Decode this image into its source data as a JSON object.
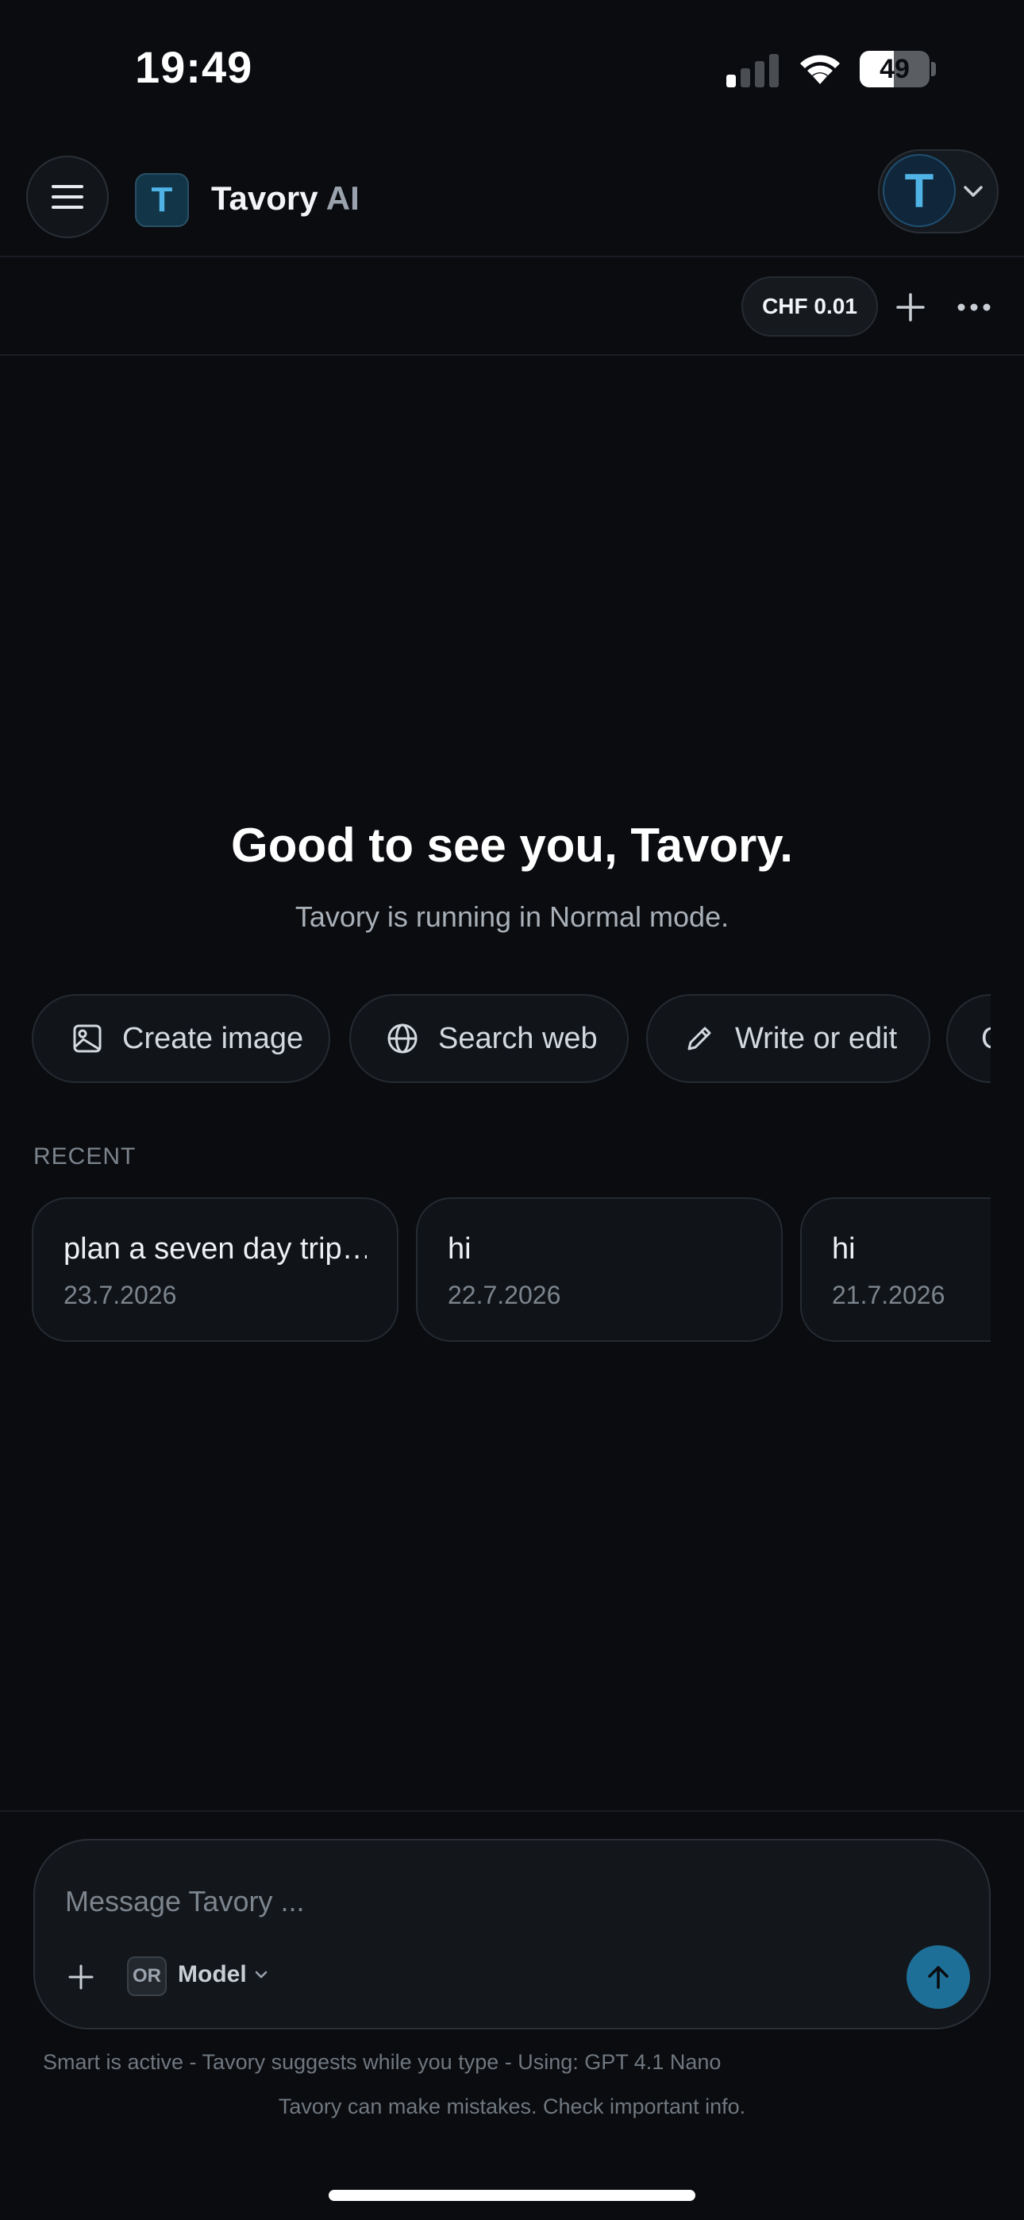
{
  "status_bar": {
    "time": "19:49",
    "battery_percent": "49",
    "battery_level": 0.49
  },
  "header": {
    "logo_letter": "T",
    "brand_name": "Tavory",
    "brand_suffix": " AI",
    "avatar_letter": "T"
  },
  "toolbar": {
    "cost": "CHF 0.01"
  },
  "main": {
    "greeting": "Good to see you, Tavory.",
    "subtitle": "Tavory is running in Normal mode.",
    "actions": [
      {
        "label": "Create image",
        "icon": "image-icon"
      },
      {
        "label": "Search web",
        "icon": "globe-icon"
      },
      {
        "label": "Write or edit",
        "icon": "pencil-icon"
      },
      {
        "label": "C",
        "icon": ""
      }
    ],
    "recent_label": "RECENT",
    "recent": [
      {
        "title": "plan a seven day trip…",
        "date": "23.7.2026"
      },
      {
        "title": "hi",
        "date": "22.7.2026"
      },
      {
        "title": "hi",
        "date": "21.7.2026"
      }
    ]
  },
  "composer": {
    "placeholder": "Message Tavory ...",
    "value": "",
    "or_badge": "OR",
    "model_label": "Model"
  },
  "footer": {
    "smart_note": "Smart is active - Tavory suggests while you type - Using: GPT 4.1 Nano",
    "disclaimer": "Tavory can make mistakes. Check important info."
  },
  "colors": {
    "background": "#0a0c10",
    "accent": "#1e6f97",
    "logo_accent": "#4fb3e6"
  }
}
